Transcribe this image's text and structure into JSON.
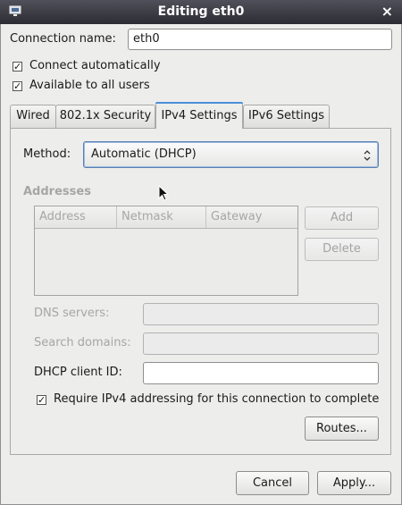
{
  "window": {
    "title": "Editing eth0",
    "close_glyph": "×",
    "icon": "network-connection-icon"
  },
  "connection_name": {
    "label": "Connection name:",
    "value": "eth0"
  },
  "checkboxes": [
    {
      "label": "Connect automatically",
      "checked": true
    },
    {
      "label": "Available to all users",
      "checked": true
    }
  ],
  "tabs": [
    {
      "label": "Wired",
      "active": false
    },
    {
      "label": "802.1x Security",
      "active": false
    },
    {
      "label": "IPv4 Settings",
      "active": true
    },
    {
      "label": "IPv6 Settings",
      "active": false
    }
  ],
  "ipv4": {
    "method_label": "Method:",
    "method_value": "Automatic (DHCP)",
    "addresses_heading": "Addresses",
    "columns": [
      "Address",
      "Netmask",
      "Gateway"
    ],
    "add_label": "Add",
    "delete_label": "Delete",
    "dns_label": "DNS servers:",
    "dns_value": "",
    "search_label": "Search domains:",
    "search_value": "",
    "dhcp_label": "DHCP client ID:",
    "dhcp_value": "",
    "require_label": "Require IPv4 addressing for this connection to complete",
    "require_checked": true,
    "routes_label": "Routes..."
  },
  "footer": {
    "cancel_label": "Cancel",
    "apply_label": "Apply..."
  }
}
